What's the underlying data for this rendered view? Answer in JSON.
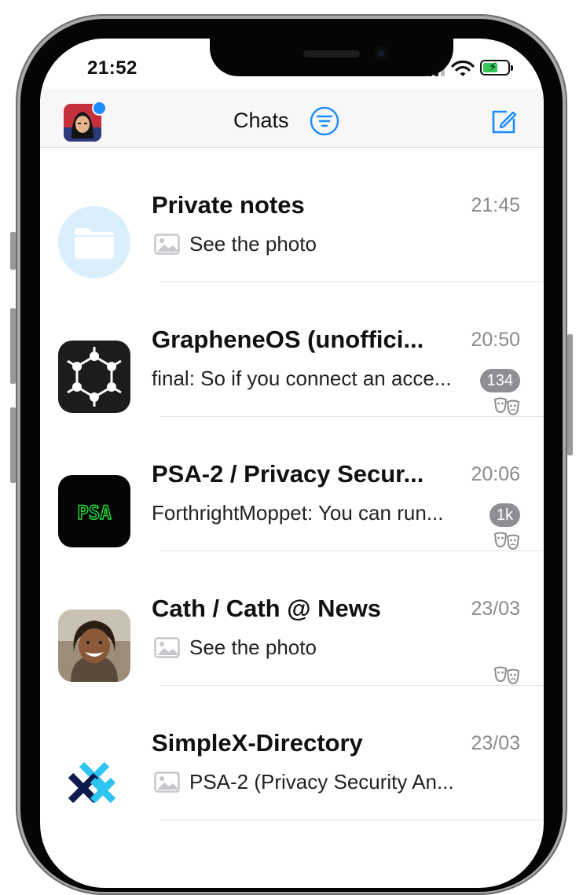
{
  "status_bar": {
    "time": "21:52"
  },
  "header": {
    "title": "Chats"
  },
  "chats": [
    {
      "name": "Private notes",
      "time": "21:45",
      "preview": "See the photo",
      "avatar": "folder-icon"
    },
    {
      "name": "GrapheneOS (unoffici...",
      "time": "20:50",
      "preview": "final: So if you connect an acce...",
      "badge": "134",
      "incognito": true,
      "avatar": "graphene-logo"
    },
    {
      "name": "PSA-2 / Privacy Secur...",
      "time": "20:06",
      "preview": "ForthrightMoppet: You can run...",
      "badge": "1k",
      "incognito": true,
      "avatar": "psa-logo",
      "avatar_text": "PSA"
    },
    {
      "name": "Cath / Cath @ News",
      "time": "23/03",
      "preview": "See the photo",
      "incognito": true,
      "avatar": "person-photo"
    },
    {
      "name": "SimpleX-Directory",
      "time": "23/03",
      "preview": "PSA-2 (Privacy Security An...",
      "avatar": "simplex-logo"
    }
  ],
  "colors": {
    "accent": "#1a8cff",
    "badge": "#8e8e93",
    "psa_green": "#22e33a"
  }
}
